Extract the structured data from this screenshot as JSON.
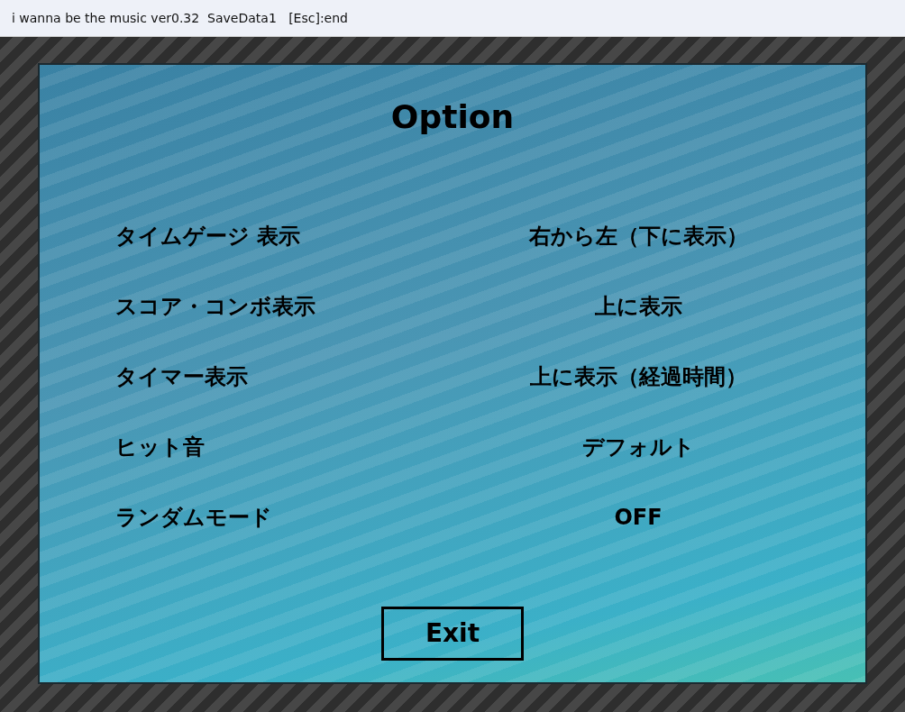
{
  "window": {
    "title": "i wanna be the music ver0.32  SaveData1   [Esc]:end"
  },
  "screen": {
    "title": "Option"
  },
  "options": [
    {
      "label": "タイムゲージ 表示",
      "value": "右から左（下に表示）"
    },
    {
      "label": "スコア・コンボ表示",
      "value": "上に表示"
    },
    {
      "label": "タイマー表示",
      "value": "上に表示（経過時間）"
    },
    {
      "label": "ヒット音",
      "value": "デフォルト"
    },
    {
      "label": "ランダムモード",
      "value": "OFF"
    }
  ],
  "exit_button": {
    "label": "Exit"
  }
}
